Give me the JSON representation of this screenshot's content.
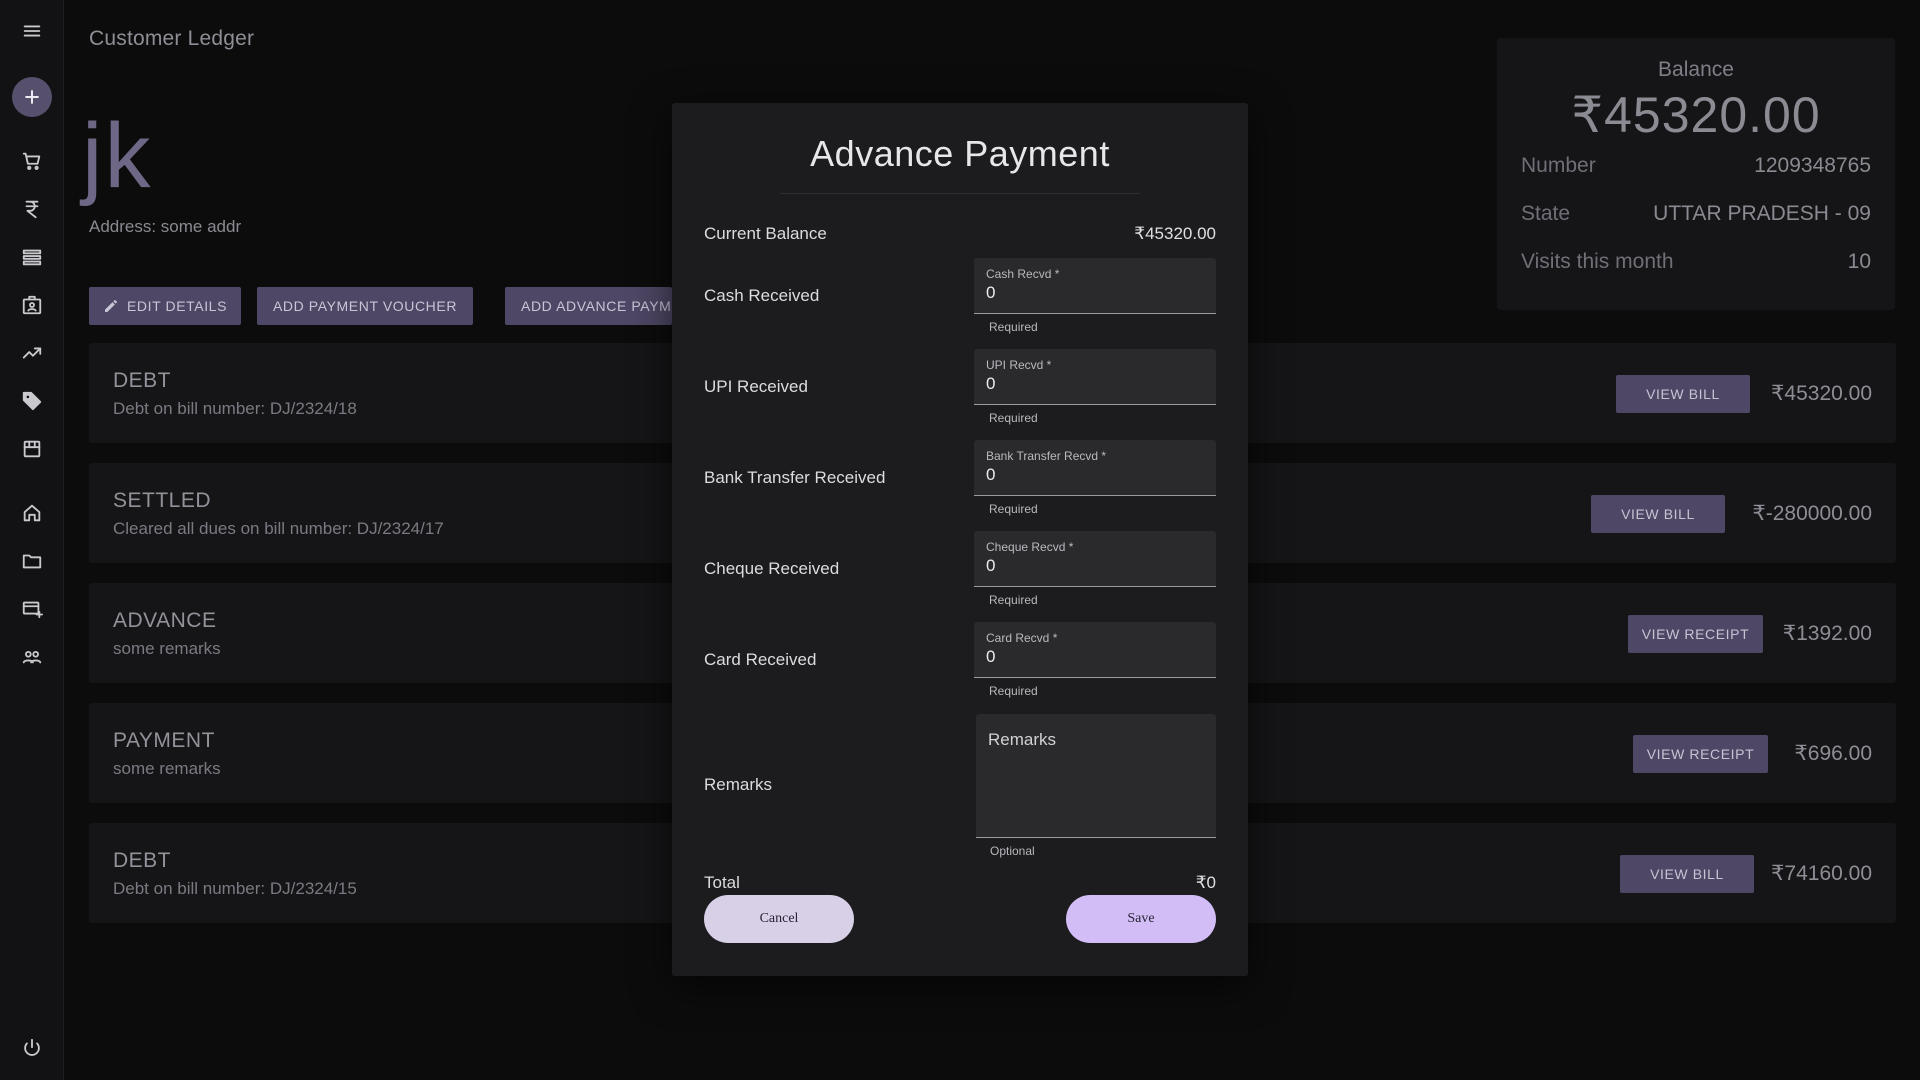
{
  "app": {
    "title": "Customer Ledger"
  },
  "sidebar": {
    "items": [
      {
        "icon": "menu-icon"
      },
      {
        "icon": "add-icon"
      },
      {
        "icon": "cart-icon"
      },
      {
        "icon": "rupee-icon"
      },
      {
        "icon": "list-icon"
      },
      {
        "icon": "contact-card-icon"
      },
      {
        "icon": "trending-icon"
      },
      {
        "icon": "tag-icon"
      },
      {
        "icon": "store-icon"
      },
      {
        "icon": "home-icon"
      },
      {
        "icon": "folder-icon"
      },
      {
        "icon": "add-card-icon"
      },
      {
        "icon": "people-icon"
      },
      {
        "icon": "power-icon"
      }
    ]
  },
  "customer": {
    "name": "jk",
    "address": "Address: some addr"
  },
  "actions": {
    "edit": "EDIT DETAILS",
    "payment_voucher": "ADD PAYMENT VOUCHER",
    "advance_payment": "ADD ADVANCE PAYMENT"
  },
  "info": {
    "balance_label": "Balance",
    "balance_value": "₹45320.00",
    "number_label": "Number",
    "number_value": "1209348765",
    "state_label": "State",
    "state_value": "UTTAR PRADESH - 09",
    "visits_label": "Visits this month",
    "visits_value": "10"
  },
  "ledger": [
    {
      "type": "DEBT",
      "desc": "Debt on bill number: DJ/2324/18",
      "button": "VIEW BILL",
      "amount": "₹45320.00"
    },
    {
      "type": "SETTLED",
      "desc": "Cleared all dues on bill number: DJ/2324/17",
      "button": "VIEW BILL",
      "amount": "₹-280000.00"
    },
    {
      "type": "ADVANCE",
      "desc": "some remarks",
      "button": "VIEW RECEIPT",
      "amount": "₹1392.00"
    },
    {
      "type": "PAYMENT",
      "desc": "some remarks",
      "button": "VIEW RECEIPT",
      "amount": "₹696.00"
    },
    {
      "type": "DEBT",
      "desc": "Debt on bill number: DJ/2324/15",
      "button": "VIEW BILL",
      "amount": "₹74160.00"
    }
  ],
  "modal": {
    "title": "Advance Payment",
    "current_balance_label": "Current Balance",
    "current_balance_value": "₹45320.00",
    "fields": [
      {
        "label": "Cash Received",
        "field_label": "Cash Recvd *",
        "value": "0",
        "helper": "Required"
      },
      {
        "label": "UPI Received",
        "field_label": "UPI Recvd *",
        "value": "0",
        "helper": "Required"
      },
      {
        "label": "Bank Transfer Received",
        "field_label": "Bank Transfer Recvd *",
        "value": "0",
        "helper": "Required"
      },
      {
        "label": "Cheque Received",
        "field_label": "Cheque Recvd *",
        "value": "0",
        "helper": "Required"
      },
      {
        "label": "Card Received",
        "field_label": "Card Recvd *",
        "value": "0",
        "helper": "Required"
      }
    ],
    "remarks_label": "Remarks",
    "remarks_placeholder": "Remarks",
    "remarks_helper": "Optional",
    "total_label": "Total",
    "total_value": "₹0",
    "cancel": "Cancel",
    "save": "Save"
  }
}
